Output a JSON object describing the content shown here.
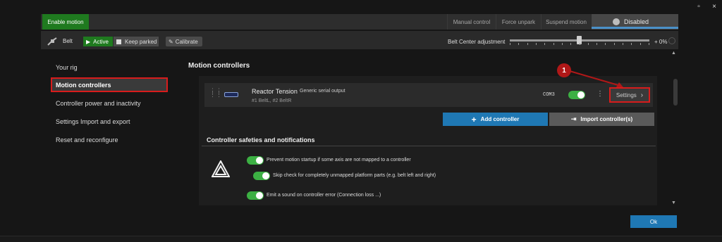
{
  "window": {
    "controls": [
      "▫",
      "×"
    ]
  },
  "topbar": {
    "enable_motion": "Enable motion",
    "manual_control": "Manual control",
    "force_unpark": "Force unpark",
    "suspend_motion": "Suspend motion",
    "disabled": "Disabled"
  },
  "belt_row": {
    "label": "Belt",
    "active": "Active",
    "keep_parked": "Keep parked",
    "calibrate": "Calibrate",
    "center_adjust_label": "Belt Center adjustment",
    "center_adjust_value": "+ 0%"
  },
  "sidebar": {
    "items": [
      {
        "label": "Your rig"
      },
      {
        "label": "Motion controllers"
      },
      {
        "label": "Controller power and inactivity"
      },
      {
        "label": "Settings Import and export"
      },
      {
        "label": "Reset and reconfigure"
      }
    ]
  },
  "main": {
    "heading": "Motion controllers",
    "controller": {
      "name": "Reactor Tension",
      "type": "Generic serial output",
      "axes": "#1 BeltL, #2 BeltR",
      "port": "COM3",
      "settings_label": "Settings"
    },
    "callout_number": "1",
    "add_controller": "Add controller",
    "import_controller": "Import controller(s)",
    "safeties_title": "Controller safeties and notifications",
    "options": [
      "Prevent motion startup if some axis are not mapped to a controller",
      "Skip check for completely unmapped platform parts (e.g. belt left and right)",
      "Emit a sound on controller error (Connection loss ...)"
    ],
    "ok": "Ok"
  },
  "colors": {
    "accent": "#1f78b4",
    "green": "#1f7a1f",
    "highlight": "#d81c1c"
  }
}
